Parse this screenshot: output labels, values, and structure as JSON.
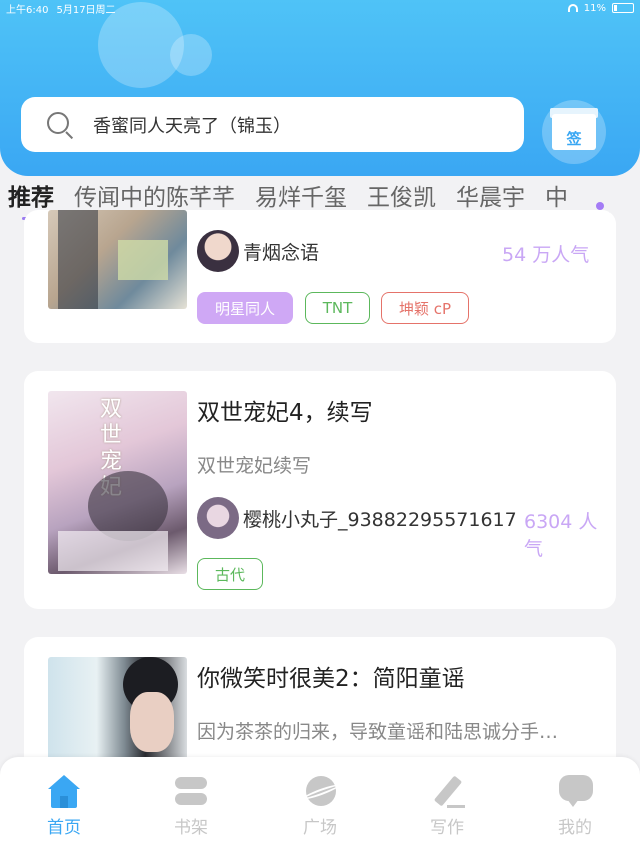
{
  "status_bar": {
    "time": "上午6:40",
    "date": "5月17日周二",
    "battery": "11%"
  },
  "search": {
    "placeholder": "香蜜同人天亮了（锦玉）"
  },
  "gift": {
    "label": "签"
  },
  "tabs": [
    {
      "label": "推荐",
      "active": true
    },
    {
      "label": "传闻中的陈芊芊"
    },
    {
      "label": "易烊千玺"
    },
    {
      "label": "王俊凯"
    },
    {
      "label": "华晨宇"
    },
    {
      "label": "中"
    }
  ],
  "cards": [
    {
      "author": "青烟念语",
      "popularity": "54 万人气",
      "tags": [
        {
          "label": "明星同人",
          "style": "filled-purple"
        },
        {
          "label": "TNT",
          "style": "outline-green"
        },
        {
          "label": "坤颖 cP",
          "style": "outline-red"
        }
      ]
    },
    {
      "title": "双世宠妃4，续写",
      "description": "双世宠妃续写",
      "author": "樱桃小丸子_93882295571617",
      "popularity": "6304 人气",
      "cover_text": "双世宠妃",
      "tags": [
        {
          "label": "古代",
          "style": "outline-green"
        }
      ]
    },
    {
      "title": "你微笑时很美2：简阳童谣",
      "description": "因为茶茶的归来，导致童谣和陆思诚分手…"
    }
  ],
  "nav": [
    {
      "label": "首页",
      "icon": "home-icon",
      "active": true
    },
    {
      "label": "书架",
      "icon": "bookshelf-icon"
    },
    {
      "label": "广场",
      "icon": "planet-icon"
    },
    {
      "label": "写作",
      "icon": "pen-icon"
    },
    {
      "label": "我的",
      "icon": "chat-bubble-icon"
    }
  ],
  "colors": {
    "brand_blue": "#3aa7f3",
    "accent_purple": "#a47cf5",
    "tag_green": "#5cb85c",
    "tag_red": "#e5736a"
  }
}
